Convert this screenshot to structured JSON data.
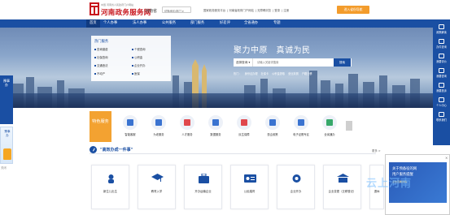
{
  "header": {
    "logo_small": "中国·河南省人民政府门户网站",
    "logo_title": "河南政务服务网",
    "region": "河南省",
    "region_select": "切换地区/部门 ▾",
    "links": [
      "国家政务服务平台",
      "河南省政府门户网站",
      "无障碍浏览",
      "登录",
      "注册"
    ],
    "service_button": "进入省份导航"
  },
  "nav": {
    "items": [
      "首页",
      "个人办事",
      "法人办事",
      "公共服务",
      "部门服务",
      "好差评",
      "全省通办",
      "专题"
    ]
  },
  "hot": {
    "title": "热门服务",
    "items": [
      "查询缴费",
      "个税查询",
      "社保查询",
      "公积金",
      "交通违法",
      "企业开办",
      "不动产",
      "医保"
    ]
  },
  "hero": {
    "slogan": "聚力中原　真诚为民",
    "search_category": "选择查询 ▾",
    "search_placeholder": "请输入关键词搜索",
    "search_button": "搜索",
    "hot_search_label": "热门：",
    "hot_search": [
      "身份证办理",
      "社保卡",
      "公积金提取",
      "营业执照",
      "户籍迁移"
    ]
  },
  "left_float": {
    "label": "豫事办",
    "banner": "豫事办",
    "close": "关闭"
  },
  "right_float": {
    "items": [
      "政策解读",
      "办件查询",
      "我要评价",
      "我要咨询",
      "我要投诉",
      "个人中心",
      "联系我们"
    ]
  },
  "services": {
    "tag": "特色服务",
    "items": [
      {
        "label": "智能客服",
        "icon": "robot-icon"
      },
      {
        "label": "为老服务",
        "icon": "elder-icon"
      },
      {
        "label": "人才服务",
        "icon": "talent-icon"
      },
      {
        "label": "数据服务",
        "icon": "data-icon"
      },
      {
        "label": "民生保障",
        "icon": "shield-icon"
      },
      {
        "label": "惠企政策",
        "icon": "policy-icon"
      },
      {
        "label": "电子证照专区",
        "icon": "certificate-icon"
      },
      {
        "label": "全省通办",
        "icon": "province-icon"
      }
    ]
  },
  "one_thing": {
    "title": "\"高效办成一件事\"",
    "more": "更多 >",
    "cards": [
      {
        "label": "新生儿出生",
        "icon": "baby-icon"
      },
      {
        "label": "教育入学",
        "icon": "school-icon"
      },
      {
        "label": "开办运输企业",
        "icon": "briefcase-icon"
      },
      {
        "label": "公民婚育",
        "icon": "id-card-icon"
      },
      {
        "label": "企业开办",
        "icon": "gear-icon"
      },
      {
        "label": "企业变更（迁移登记）",
        "icon": "building-icon"
      },
      {
        "label": "退休",
        "icon": "retire-icon"
      }
    ]
  },
  "popup": {
    "line1": "关于预备役的网",
    "line2": "用户服务提醒",
    "line3": "点击查看详情",
    "close": "×"
  },
  "watermark": "云上河南"
}
